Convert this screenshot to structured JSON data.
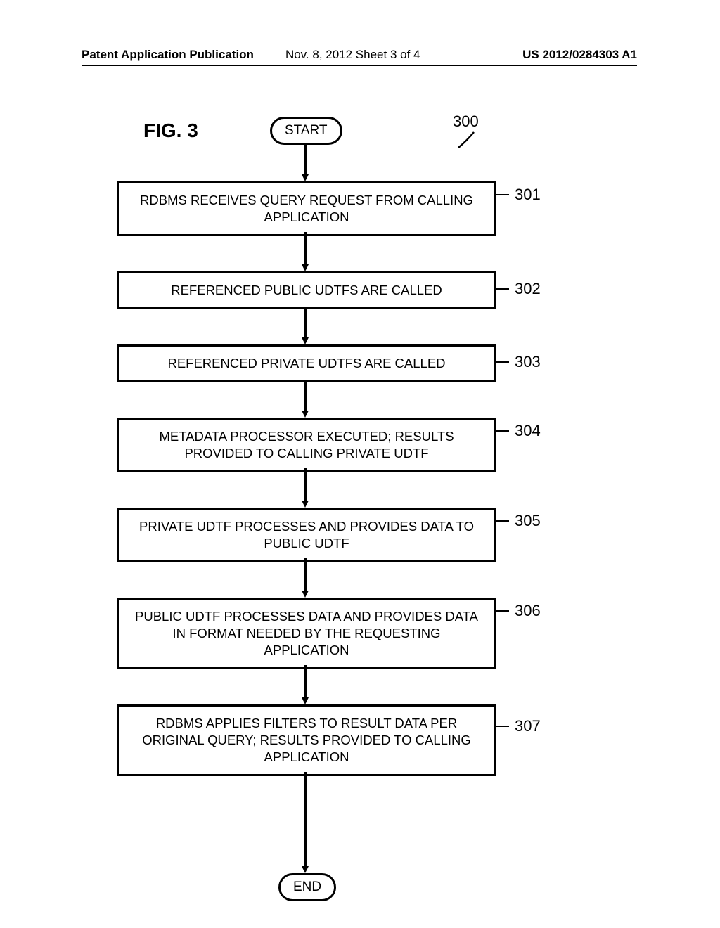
{
  "header": {
    "left": "Patent Application Publication",
    "center": "Nov. 8, 2012  Sheet 3 of 4",
    "right": "US 2012/0284303 A1"
  },
  "figure": {
    "title": "FIG. 3",
    "ref_number": "300",
    "start_label": "START",
    "end_label": "END",
    "steps": [
      {
        "ref": "301",
        "text": "RDBMS RECEIVES QUERY REQUEST FROM CALLING APPLICATION"
      },
      {
        "ref": "302",
        "text": "REFERENCED PUBLIC UDTFS ARE CALLED"
      },
      {
        "ref": "303",
        "text": "REFERENCED PRIVATE UDTFS ARE CALLED"
      },
      {
        "ref": "304",
        "text": "METADATA PROCESSOR EXECUTED; RESULTS PROVIDED TO CALLING PRIVATE UDTF"
      },
      {
        "ref": "305",
        "text": "PRIVATE UDTF PROCESSES AND PROVIDES DATA TO PUBLIC UDTF"
      },
      {
        "ref": "306",
        "text": "PUBLIC UDTF PROCESSES DATA AND PROVIDES DATA IN FORMAT NEEDED BY THE REQUESTING APPLICATION"
      },
      {
        "ref": "307",
        "text": "RDBMS APPLIES FILTERS TO RESULT DATA PER ORIGINAL QUERY; RESULTS PROVIDED TO CALLING APPLICATION"
      }
    ]
  }
}
